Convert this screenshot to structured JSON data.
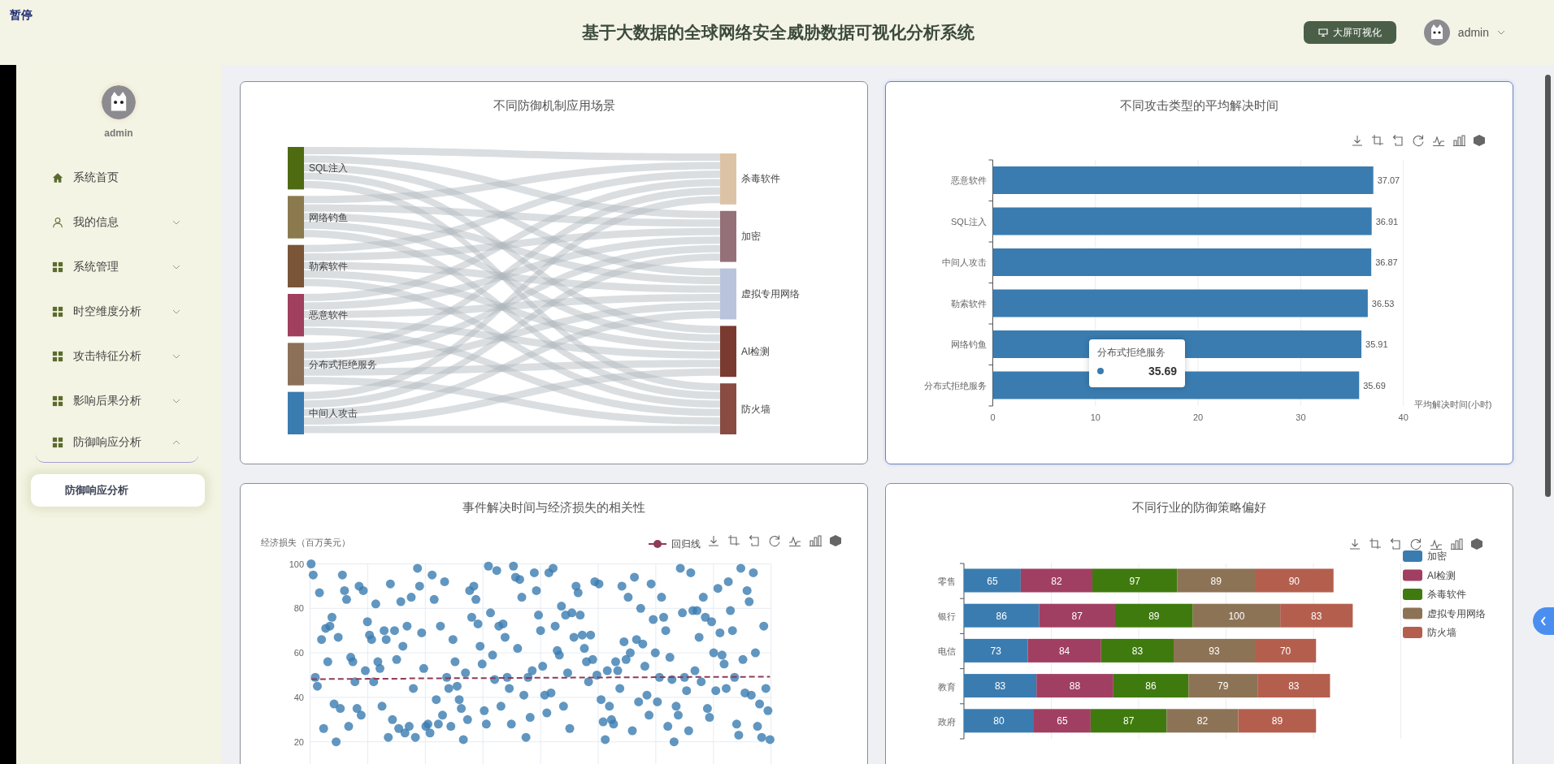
{
  "overlay": {
    "label": "暂停"
  },
  "header": {
    "title": "基于大数据的全球网络安全威胁数据可视化分析系统",
    "screen_button": "大屏可视化",
    "user": "admin"
  },
  "sidebar": {
    "user": "admin",
    "items": [
      {
        "label": "系统首页"
      },
      {
        "label": "我的信息",
        "expanded": false
      },
      {
        "label": "系统管理",
        "expanded": false
      },
      {
        "label": "时空维度分析",
        "expanded": false
      },
      {
        "label": "攻击特征分析",
        "expanded": false
      },
      {
        "label": "影响后果分析",
        "expanded": false
      },
      {
        "label": "防御响应分析",
        "expanded": true,
        "children": [
          {
            "label": "防御响应分析",
            "selected": true
          }
        ]
      }
    ]
  },
  "panels": [
    {
      "kind": "sankey",
      "title": "不同防御机制应用场景",
      "hovered": false,
      "sources": [
        {
          "label": "SQL注入",
          "color": "#4e6b12"
        },
        {
          "label": "网络钓鱼",
          "color": "#8b7a4e"
        },
        {
          "label": "勒索软件",
          "color": "#7a5538"
        },
        {
          "label": "恶意软件",
          "color": "#a0405e"
        },
        {
          "label": "分布式拒绝服务",
          "color": "#8d7058"
        },
        {
          "label": "中间人攻击",
          "color": "#3a7cb0"
        }
      ],
      "targets": [
        {
          "label": "杀毒软件",
          "color": "#ddc3a5"
        },
        {
          "label": "加密",
          "color": "#957079"
        },
        {
          "label": "虚拟专用网络",
          "color": "#b9c3dc"
        },
        {
          "label": "AI检测",
          "color": "#7b3a30"
        },
        {
          "label": "防火墙",
          "color": "#894b42"
        }
      ]
    },
    {
      "kind": "bar",
      "title": "不同攻击类型的平均解决时间",
      "hovered": true,
      "tooltip": {
        "title": "分布式拒绝服务",
        "value": "35.69"
      },
      "chart_data": {
        "type": "bar",
        "orientation": "horizontal",
        "grid": true,
        "xlabel": "平均解决时间(小时)",
        "categories": [
          "恶意软件",
          "SQL注入",
          "中间人攻击",
          "勒索软件",
          "网络钓鱼",
          "分布式拒绝服务"
        ],
        "series": [
          {
            "color": "#3a7cb0",
            "values": [
              37.07,
              36.91,
              36.87,
              36.53,
              35.91,
              35.69
            ]
          }
        ],
        "xlim": [
          0,
          40
        ],
        "xticks": [
          0,
          10,
          20,
          30,
          40
        ],
        "data_labels": true
      }
    },
    {
      "kind": "scatter",
      "title": "事件解决时间与经济损失的相关性",
      "hovered": false,
      "chart_data": {
        "type": "scatter",
        "grid": true,
        "legend": true,
        "ylabel": "经济损失（百万美元）",
        "ylim": [
          0,
          100
        ],
        "yticks": [
          20,
          40,
          60,
          80,
          100
        ],
        "categories": [
          null,
          null,
          null,
          null,
          null,
          null,
          null,
          null,
          null,
          null,
          null,
          null,
          null,
          null,
          null,
          null,
          null,
          null,
          null,
          null,
          null,
          null,
          null,
          null,
          null,
          null,
          null,
          null,
          null,
          null,
          null,
          null,
          null,
          null,
          null,
          null,
          null,
          null,
          null,
          null,
          null,
          null,
          null,
          null,
          null,
          null,
          null,
          null,
          null,
          null,
          null,
          null,
          null,
          null,
          null,
          null,
          null,
          null,
          null,
          null,
          null,
          null,
          null,
          null,
          null,
          null,
          null,
          null,
          null,
          null,
          null,
          null,
          null,
          null,
          null,
          null,
          null,
          null,
          null,
          null,
          null,
          null,
          null,
          null,
          null,
          null,
          null,
          null,
          null,
          null,
          null,
          null,
          null,
          null,
          null,
          null,
          null,
          null,
          null,
          null,
          null,
          null,
          null,
          null,
          null,
          null,
          null,
          null,
          null,
          null,
          null,
          null,
          null,
          null,
          null,
          null,
          null,
          null,
          null,
          null,
          null,
          null,
          null,
          null,
          null,
          null,
          null,
          null,
          null,
          null,
          null,
          null,
          null,
          null,
          null,
          null,
          null,
          null,
          null,
          null,
          null,
          null,
          null,
          null,
          null,
          null,
          null,
          null,
          null,
          null,
          null,
          null,
          null,
          null,
          null,
          null,
          null,
          null,
          null,
          null,
          null,
          null,
          null,
          null,
          null,
          null,
          null,
          null,
          null,
          null,
          null,
          null,
          null,
          null,
          null,
          null,
          null,
          null,
          null,
          null,
          null,
          null,
          null,
          null,
          null,
          null,
          null,
          null,
          null,
          null,
          null,
          null,
          null,
          null,
          null,
          null,
          null,
          null,
          null,
          null,
          null,
          null,
          null,
          null,
          null,
          null,
          null,
          null,
          null,
          null,
          null,
          null,
          null,
          null,
          null,
          null,
          null,
          null,
          null,
          null,
          null
        ],
        "series": [
          {
            "color": "#3a7cb0",
            "values": [
              100,
              95,
              49,
              45,
              87,
              66,
              26,
              71,
              56,
              72,
              76,
              37,
              20,
              67,
              35,
              95,
              88,
              84,
              27,
              58,
              56,
              47,
              35,
              90,
              32,
              88,
              52,
              74,
              68,
              66,
              47,
              82,
              56,
              53,
              36,
              70,
              66,
              22,
              91,
              30,
              70,
              57,
              26,
              83,
              63,
              24,
              72,
              27,
              85,
              44,
              22,
              98,
              90,
              69,
              53,
              27,
              28,
              24,
              95,
              84,
              39,
              28,
              72,
              32,
              92,
              49,
              44,
              27,
              66,
              56,
              45,
              39,
              35,
              21,
              51,
              30,
              88,
              76,
              90,
              84,
              73,
              63,
              55,
              34,
              28,
              99,
              78,
              59,
              48,
              97,
              72,
              36,
              73,
              67,
              49,
              44,
              28,
              99,
              94,
              62,
              93,
              85,
              41,
              22,
              49,
              31,
              52,
              96,
              88,
              77,
              70,
              54,
              41,
              33,
              96,
              42,
              98,
              72,
              61,
              59,
              81,
              36,
              77,
              51,
              26,
              78,
              67,
              90,
              87,
              77,
              68,
              62,
              56,
              47,
              68,
              57,
              92,
              50,
              91,
              39,
              29,
              21,
              52,
              36,
              30,
              28,
              56,
              52,
              44,
              90,
              65,
              57,
              85,
              60,
              25,
              94,
              66,
              38,
              80,
              64,
              54,
              41,
              32,
              91,
              75,
              60,
              38,
              49,
              85,
              76,
              70,
              27,
              58,
              48,
              20,
              36,
              32,
              98,
              78,
              49,
              43,
              25,
              96,
              79,
              52,
              79,
              67,
              47,
              85,
              76,
              35,
              31,
              74,
              60,
              43,
              89,
              69,
              59,
              55,
              44,
              92,
              79,
              70,
              49,
              28,
              23,
              98,
              57,
              42,
              88,
              83,
              41,
              96,
              60,
              27,
              37,
              22,
              72,
              44,
              34,
              21
            ]
          },
          {
            "name": "回归线",
            "type": "line",
            "line_style": "dashed",
            "color": "#8e3b55",
            "values": [
              48.2,
              48.2,
              48.2,
              48.2,
              48.2,
              48.2,
              48.2,
              48.2,
              48.2,
              48.3,
              48.3,
              48.3,
              48.3,
              48.3,
              48.3,
              48.3,
              48.3,
              48.3,
              48.3,
              48.3,
              48.3,
              48.3,
              48.3,
              48.3,
              48.3,
              48.3,
              48.3,
              48.4,
              48.4,
              48.4,
              48.4,
              48.4,
              48.4,
              48.4,
              48.4,
              48.4,
              48.4,
              48.4,
              48.4,
              48.4,
              48.4,
              48.4,
              48.4,
              48.4,
              48.4,
              48.4,
              48.5,
              48.5,
              48.5,
              48.5,
              48.5,
              48.5,
              48.5,
              48.5,
              48.5,
              48.5,
              48.5,
              48.5,
              48.5,
              48.5,
              48.5,
              48.5,
              48.5,
              48.5,
              48.5,
              48.5,
              48.6,
              48.6,
              48.6,
              48.6,
              48.6,
              48.6,
              48.6,
              48.6,
              48.6,
              48.6,
              48.6,
              48.6,
              48.6,
              48.6,
              48.6,
              48.6,
              48.6,
              48.6,
              48.6,
              48.6,
              48.6,
              48.6,
              48.6,
              48.7,
              48.7,
              48.7,
              48.7,
              48.7,
              48.7,
              48.7,
              48.7,
              48.7,
              48.7,
              48.7,
              48.7,
              48.7,
              48.7,
              48.7,
              48.7,
              48.7,
              48.7,
              48.8,
              48.8,
              48.8,
              48.8,
              48.8,
              48.8,
              48.8,
              48.8,
              48.8,
              48.8,
              48.8,
              48.8,
              48.8,
              48.8,
              48.8,
              48.8,
              48.8,
              48.8,
              48.9,
              48.9,
              48.9,
              48.9,
              48.9,
              48.9,
              48.9,
              48.9,
              48.9,
              48.9,
              48.9,
              48.9,
              48.9,
              48.9,
              48.9,
              48.9,
              48.9,
              48.9,
              49,
              49,
              49,
              49,
              49,
              49,
              49,
              49,
              49,
              49,
              49,
              49,
              49,
              49,
              49,
              49,
              49,
              49,
              49,
              49,
              49,
              49.1,
              49.1,
              49.1,
              49.1,
              49.1,
              49.1,
              49.1,
              49.1,
              49.1,
              49.1,
              49.1,
              49.1,
              49.1,
              49.1,
              49.1,
              49.1,
              49.1,
              49.1,
              49.2,
              49.2,
              49.2,
              49.2,
              49.2,
              49.2,
              49.2,
              49.2,
              49.2,
              49.2,
              49.2,
              49.2,
              49.2,
              49.2,
              49.2,
              49.2,
              49.2,
              49.2,
              49.2,
              49.2,
              49.2,
              49.2,
              49.2,
              49.2,
              49.2,
              49.2,
              49.2,
              49.3,
              49.3,
              49.3,
              49.3,
              49.3,
              49.3,
              49.3,
              49.3,
              49.3,
              49.3,
              49.3,
              49.3
            ]
          }
        ]
      }
    },
    {
      "kind": "stacked",
      "title": "不同行业的防御策略偏好",
      "hovered": false,
      "chart_data": {
        "type": "bar",
        "orientation": "horizontal",
        "stacked": true,
        "grid": true,
        "data_labels": true,
        "legend": true,
        "xlim": [
          0,
          500
        ],
        "categories": [
          "零售",
          "银行",
          "电信",
          "教育",
          "政府"
        ],
        "series": [
          {
            "name": "加密",
            "color": "#3a7cb0",
            "values": [
              65,
              86,
              73,
              83,
              80
            ]
          },
          {
            "name": "AI检测",
            "color": "#a13f62",
            "values": [
              82,
              87,
              84,
              88,
              65
            ]
          },
          {
            "name": "杀毒软件",
            "color": "#3f7a0e",
            "values": [
              97,
              89,
              83,
              86,
              87
            ]
          },
          {
            "name": "虚拟专用网络",
            "color": "#8d7356",
            "values": [
              89,
              100,
              93,
              79,
              82
            ]
          },
          {
            "name": "防火墙",
            "color": "#b45f4e",
            "values": [
              90,
              83,
              70,
              83,
              89
            ]
          }
        ]
      }
    }
  ]
}
